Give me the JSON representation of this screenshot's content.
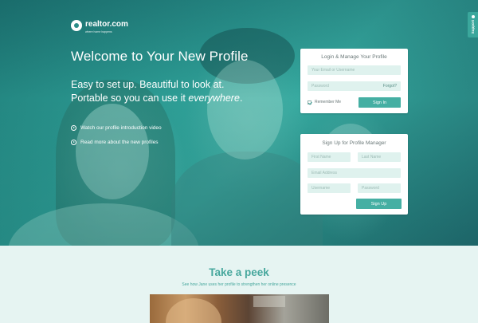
{
  "brand": {
    "name": "realtor.com",
    "tagline": "where home happens"
  },
  "hero": {
    "title": "Welcome to Your New Profile",
    "subtitle_line1": "Easy to set up. Beautiful to look at.",
    "subtitle_line2_prefix": "Portable so you can use it ",
    "subtitle_line2_emphasis": "everywhere",
    "subtitle_line2_suffix": ".",
    "links": [
      {
        "label": "Watch our profile introduction video",
        "icon": "play-circle-icon"
      },
      {
        "label": "Read more about the new profiles",
        "icon": "play-circle-icon"
      }
    ]
  },
  "support_tab": {
    "label": "Support"
  },
  "login_panel": {
    "title": "Login & Manage Your Profile",
    "email_placeholder": "Your Email or Username",
    "password_placeholder": "Password",
    "forgot_label": "Forgot?",
    "remember_label": "Remember Me",
    "remember_checked": true,
    "sign_in_label": "Sign In"
  },
  "signup_panel": {
    "title": "Sign Up for Profile Manager",
    "first_name_placeholder": "First Name",
    "last_name_placeholder": "Last Name",
    "email_placeholder": "Email Address",
    "username_placeholder": "Username",
    "password_placeholder": "Password",
    "sign_up_label": "Sign Up"
  },
  "peek": {
    "title": "Take a peek",
    "subtitle": "See how Jane uses her profile to strengthen her online presence"
  },
  "colors": {
    "accent": "#45afa3",
    "field_bg": "#dff2ee",
    "page_bg": "#e6f4f2",
    "heading_teal": "#47a79d"
  }
}
